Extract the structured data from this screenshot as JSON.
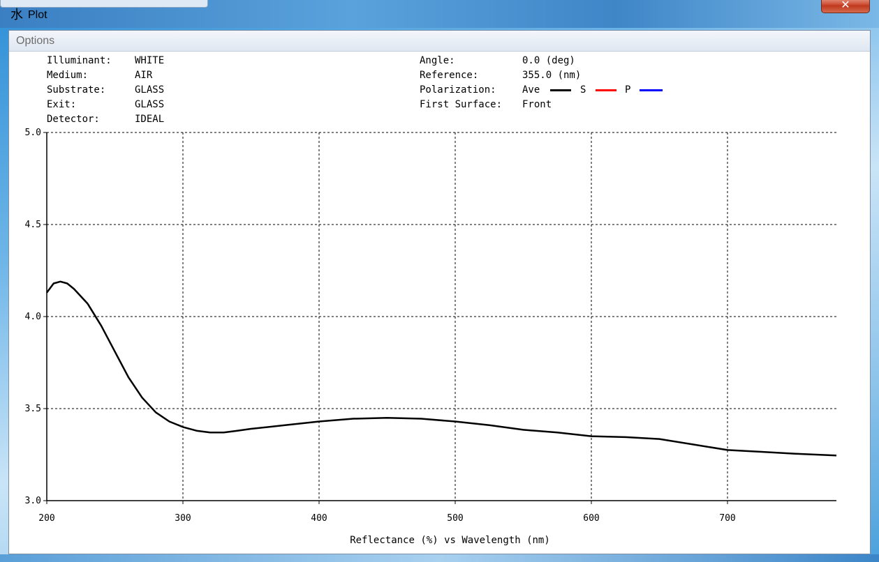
{
  "window": {
    "title": "Plot",
    "app_icon": "水",
    "close_symbol": "✕"
  },
  "menu": {
    "options_label": "Options"
  },
  "info_left": {
    "illuminant_label": "Illuminant:",
    "illuminant_value": "WHITE",
    "medium_label": "Medium:",
    "medium_value": "AIR",
    "substrate_label": "Substrate:",
    "substrate_value": "GLASS",
    "exit_label": "Exit:",
    "exit_value": "GLASS",
    "detector_label": "Detector:",
    "detector_value": "IDEAL"
  },
  "info_right": {
    "angle_label": "Angle:",
    "angle_value": "0.0 (deg)",
    "reference_label": "Reference:",
    "reference_value": "355.0 (nm)",
    "polarization_label": "Polarization:",
    "pol_ave": "Ave",
    "pol_s": "S",
    "pol_p": "P",
    "first_surface_label": "First Surface:",
    "first_surface_value": "Front"
  },
  "legend_colors": {
    "ave": "#000000",
    "s": "#ff0000",
    "p": "#0000ff"
  },
  "chart_data": {
    "type": "line",
    "xlabel": "Reflectance (%)  vs  Wavelength (nm)",
    "xlim": [
      200,
      780
    ],
    "ylim": [
      3.0,
      5.0
    ],
    "xticks": [
      200,
      300,
      400,
      500,
      600,
      700
    ],
    "yticks": [
      "3.0",
      "3.5",
      "4.0",
      "4.5",
      "5.0"
    ],
    "grid": true,
    "series": [
      {
        "name": "Ave",
        "color": "#000000",
        "x": [
          200,
          205,
          210,
          215,
          220,
          230,
          240,
          250,
          260,
          270,
          280,
          290,
          300,
          310,
          320,
          330,
          340,
          350,
          375,
          400,
          425,
          450,
          475,
          500,
          525,
          550,
          575,
          600,
          625,
          650,
          675,
          700,
          725,
          750,
          780
        ],
        "y": [
          4.13,
          4.18,
          4.19,
          4.18,
          4.15,
          4.07,
          3.95,
          3.81,
          3.67,
          3.56,
          3.48,
          3.43,
          3.4,
          3.38,
          3.37,
          3.37,
          3.38,
          3.39,
          3.41,
          3.43,
          3.445,
          3.45,
          3.445,
          3.43,
          3.41,
          3.385,
          3.37,
          3.35,
          3.345,
          3.335,
          3.305,
          3.275,
          3.265,
          3.255,
          3.245
        ]
      }
    ]
  }
}
